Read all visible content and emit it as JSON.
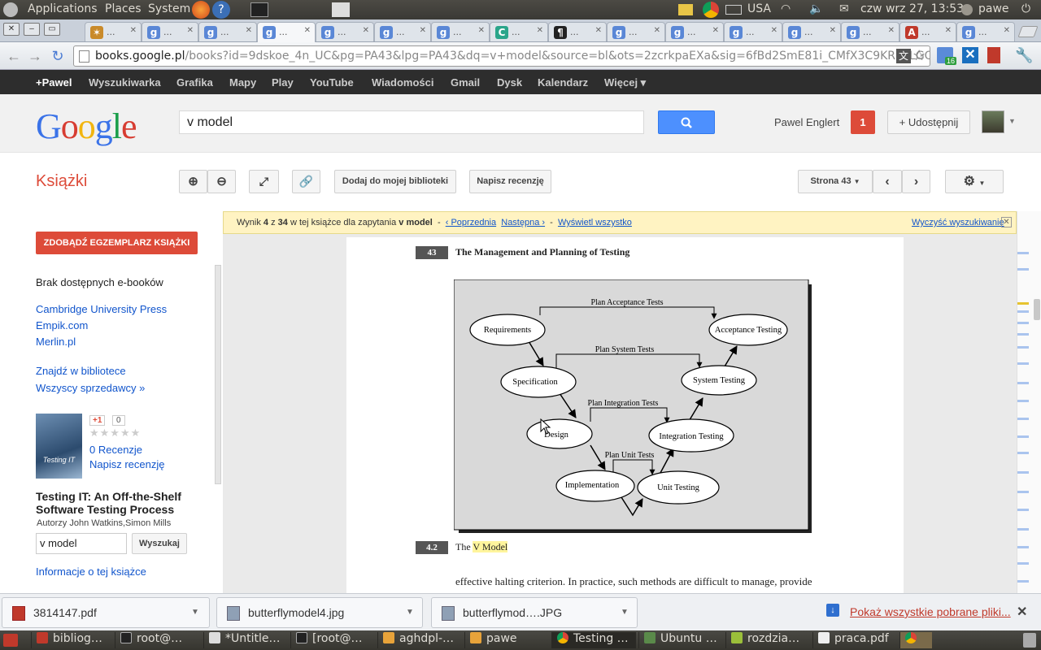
{
  "system": {
    "menus": [
      "Applications",
      "Places",
      "System"
    ],
    "keyboard": "USA",
    "clock": "czw wrz 27, 13:53",
    "user": "pawe"
  },
  "browser": {
    "url_host": "books.google.pl",
    "url_rest": "/books?id=9dskoe_4n_UC&pg=PA43&lpg=PA43&dq=v+model&source=bl&ots=2zcrkpaEXa&sig=6fBd2SmE81i_CMfX3C9KRk9LGQE8",
    "tab_placeholder": "...",
    "extension_badge": "16"
  },
  "gbar": {
    "items": [
      "+Pawel",
      "Wyszukiwarka",
      "Grafika",
      "Mapy",
      "Play",
      "YouTube",
      "Wiadomości",
      "Gmail",
      "Dysk",
      "Kalendarz",
      "Więcej ▾"
    ]
  },
  "header": {
    "logo": "Google",
    "query": "v model",
    "user_name": "Pawel Englert",
    "notif_count": "1",
    "share_label": "+ Udostępnij"
  },
  "toolbar": {
    "section_title": "Książki",
    "add_library": "Dodaj do mojej biblioteki",
    "write_review": "Napisz recenzję",
    "page_label": "Strona 43"
  },
  "sidebar": {
    "get_copy": "ZDOBĄDŹ EGZEMPLARZ KSIĄŻKI",
    "no_ebooks": "Brak dostępnych e-booków",
    "sellers": [
      "Cambridge University Press",
      "Empik.com",
      "Merlin.pl"
    ],
    "find_library": "Znajdź w bibliotece",
    "all_sellers": "Wszyscy sprzedawcy »",
    "plus_one": "+1",
    "plus_count": "0",
    "reviews": "0 Recenzje",
    "write_review": "Napisz recenzję",
    "book_title": "Testing IT: An Off-the-Shelf Software Testing Process",
    "authors": "Autorzy John Watkins,Simon Mills",
    "search_value": "v model",
    "search_btn": "Wyszukaj",
    "about": "Informacje o tej książce",
    "cover_text": "Testing IT"
  },
  "infobar": {
    "result_prefix": "Wynik",
    "result_num": "4",
    "result_of": "z",
    "result_total": "34",
    "result_mid": "w tej książce dla zapytania",
    "query": "v model",
    "prev": "‹ Poprzednia",
    "next": "Następna ›",
    "show_all": "Wyświetl wszystko",
    "clear": "Wyczyść wyszukiwanie"
  },
  "page": {
    "page_number": "43",
    "chapter_title": "The Management and Planning of Testing",
    "section_number": "4.2",
    "section_title_prefix": "The ",
    "section_title_highlight": "V Model",
    "body_text": "effective halting criterion. In practice, such methods are difficult to manage, provide",
    "diagram": {
      "nodes": [
        "Requirements",
        "Specification",
        "Design",
        "Implementation",
        "Unit Testing",
        "Integration Testing",
        "System Testing",
        "Acceptance Testing"
      ],
      "plans": [
        "Plan Acceptance Tests",
        "Plan System Tests",
        "Plan Integration Tests",
        "Plan Unit Tests"
      ]
    }
  },
  "downloads": {
    "items": [
      "3814147.pdf",
      "butterflymodel4.jpg",
      "butterflymod….JPG"
    ],
    "show_all": "Pokaż wszystkie pobrane pliki..."
  },
  "taskbar": {
    "items": [
      "bibliog…",
      "root@…",
      "*Untitle…",
      "[root@…",
      "aghdpl-…",
      "pawe",
      "Testing …",
      "Ubuntu …",
      "rozdzia…",
      "praca.pdf"
    ]
  },
  "colors": {
    "google_blue": "#4285f4",
    "red_button": "#dd4b39",
    "link_blue": "#1155cc",
    "highlight": "#fff59d"
  }
}
